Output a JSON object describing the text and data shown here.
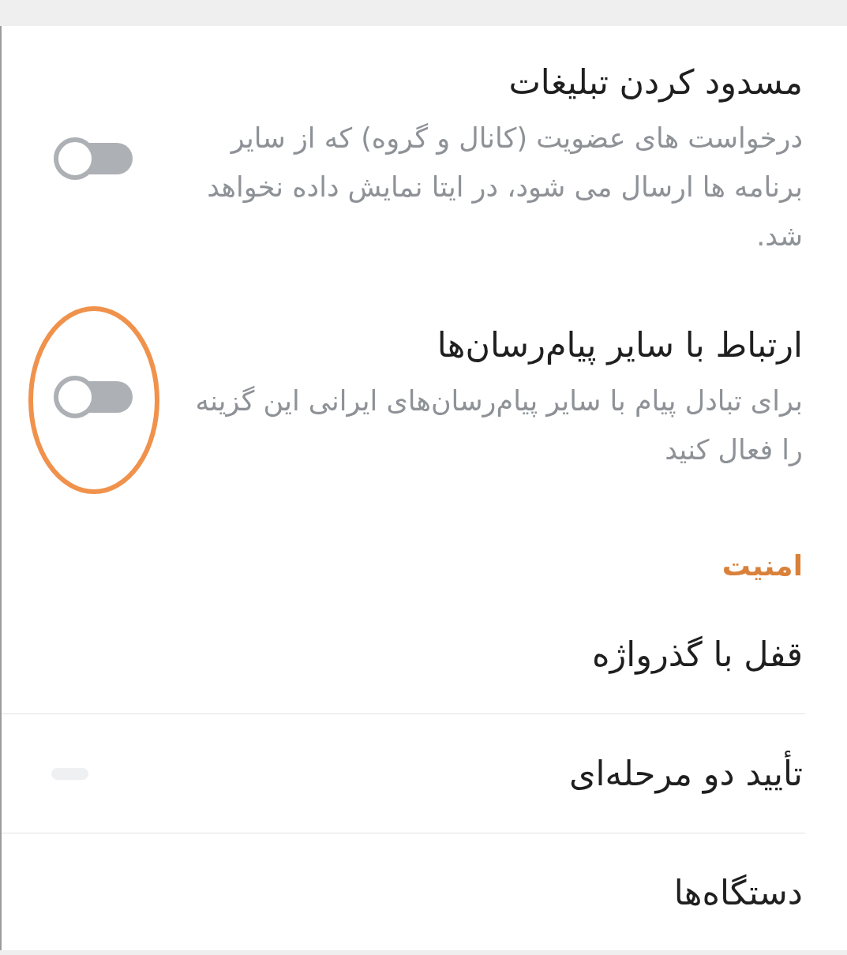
{
  "sections": [
    {
      "items": [
        {
          "kind": "toggle",
          "title": "مسدود کردن تبلیغات",
          "description": "درخواست های عضویت (کانال و گروه) که از سایر برنامه ها ارسال می شود، در ایتا نمایش داده نخواهد شد.",
          "on": false,
          "highlighted": false
        },
        {
          "kind": "toggle",
          "title": "ارتباط با سایر پیام‌رسان‌ها",
          "description": "برای تبادل پیام با سایر پیام‌رسان‌های ایرانی این گزینه را فعال کنید",
          "on": false,
          "highlighted": true
        }
      ]
    },
    {
      "header": "امنیت",
      "items": [
        {
          "kind": "link",
          "title": "قفل با گذرواژه",
          "loading": false
        },
        {
          "kind": "link",
          "title": "تأیید دو مرحله‌ای",
          "loading": true
        },
        {
          "kind": "link",
          "title": "دستگاه‌ها",
          "loading": false
        }
      ]
    }
  ]
}
